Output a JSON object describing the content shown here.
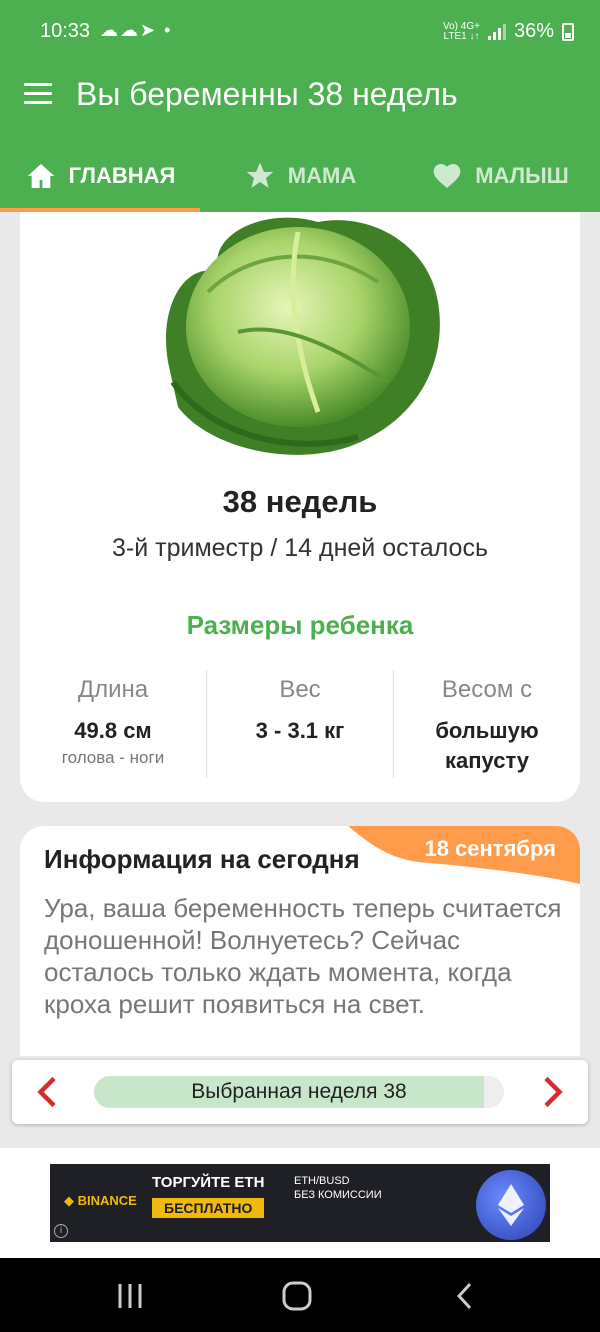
{
  "status_bar": {
    "time": "10:33",
    "notifications": "☁☁➤ •",
    "network_top": "Vo) 4G+",
    "network_bottom": "LTE1 ↓↑",
    "battery": "36%"
  },
  "app_bar": {
    "title": "Вы беременны 38 недель",
    "menu_icon": "menu-icon"
  },
  "tabs": [
    {
      "label": "ГЛАВНАЯ",
      "icon": "home-icon",
      "active": true
    },
    {
      "label": "МАМА",
      "icon": "star-icon",
      "active": false
    },
    {
      "label": "МАЛЫШ",
      "icon": "heart-icon",
      "active": false
    }
  ],
  "week_card": {
    "image": "cabbage",
    "title": "38 недель",
    "subtitle": "3-й триместр / 14 дней осталось",
    "sizes_title": "Размеры ребенка",
    "columns": [
      {
        "label": "Длина",
        "value": "49.8 см",
        "hint": "голова - ноги"
      },
      {
        "label": "Вес",
        "value": "3 - 3.1 кг",
        "hint": ""
      },
      {
        "label": "Весом с",
        "value": "большую капусту",
        "hint": ""
      }
    ]
  },
  "info_card": {
    "title": "Информация на сегодня",
    "date": "18 сентября",
    "text": "Ура, ваша беременность теперь считается доношенной! Волнуетесь? Сейчас осталось только ждать момента, когда кроха решит появиться на свет."
  },
  "week_nav": {
    "label": "Выбранная неделя 38",
    "progress": 0.95,
    "prev_icon": "chevron-left-icon",
    "next_icon": "chevron-right-icon"
  },
  "ad": {
    "brand": "◆ BINANCE",
    "headline": "ТОРГУЙТЕ ETH",
    "cta": "БЕСПЛАТНО",
    "pair": "ETH/BUSD",
    "sub": "БЕЗ КОМИССИИ"
  },
  "colors": {
    "primary": "#4caf50",
    "accent": "#ff9b4a",
    "nav_arrow": "#d32f2f",
    "progress_fill": "#c8e6c9"
  }
}
